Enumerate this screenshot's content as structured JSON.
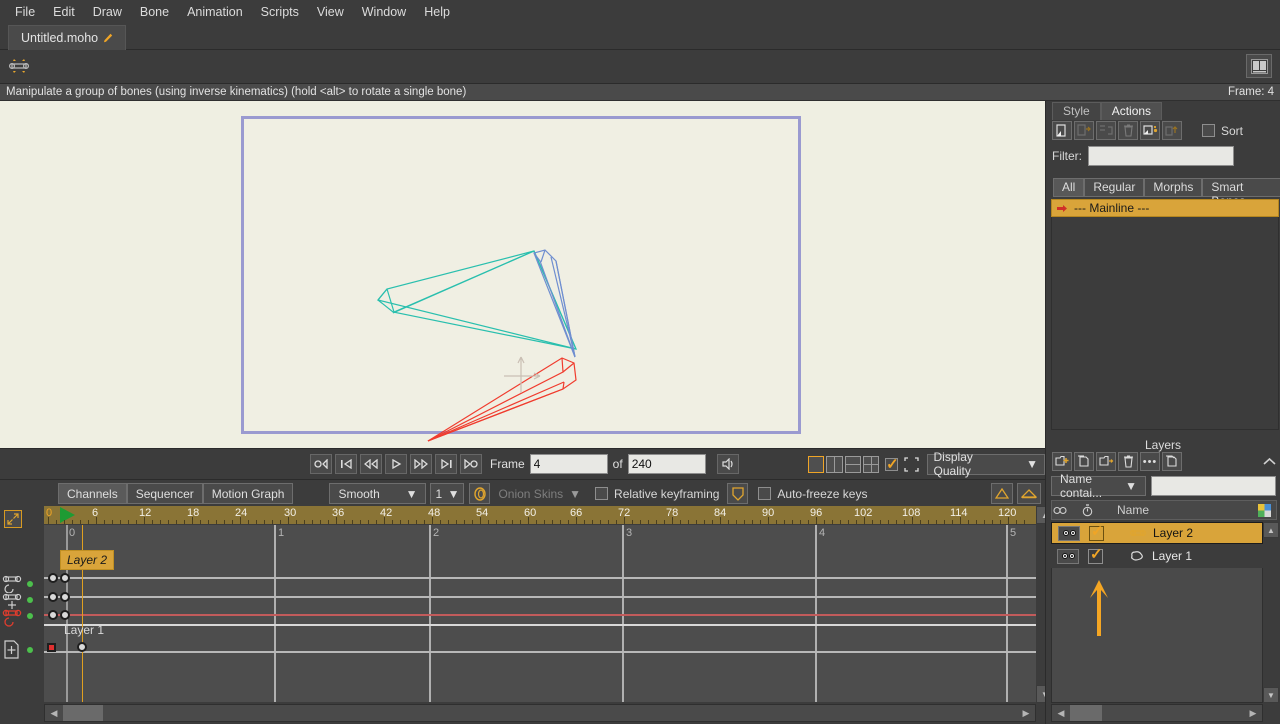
{
  "menu": {
    "items": [
      "File",
      "Edit",
      "Draw",
      "Bone",
      "Animation",
      "Scripts",
      "View",
      "Window",
      "Help"
    ]
  },
  "tabbar": {
    "document_tab": "Untitled.moho",
    "modified_marker": "✎"
  },
  "toolstrip": {
    "active_tool_icon": "manipulate-bones-icon",
    "right_icon": "book-view-icon"
  },
  "statusbar": {
    "hint": "Manipulate a group of bones (using inverse kinematics) (hold <alt> to rotate a single bone)",
    "frame_label": "Frame: 4"
  },
  "canvas": {
    "paper_color": "#f0efe3",
    "border_color": "#9a9ad0",
    "bones": [
      {
        "name": "bone-upper-arm",
        "color": "#29bfae"
      },
      {
        "name": "bone-forearm",
        "color": "#6f8ed0"
      },
      {
        "name": "bone-selected",
        "color": "#f03c2e"
      }
    ],
    "origin_gizmo": "axis-gizmo"
  },
  "playback": {
    "buttons": [
      {
        "name": "rewind-to-start-button",
        "glyph": "◁|"
      },
      {
        "name": "previous-keyframe-button",
        "glyph": "|◁"
      },
      {
        "name": "step-back-button",
        "glyph": "◁◁"
      },
      {
        "name": "play-button",
        "glyph": "▷"
      },
      {
        "name": "step-forward-button",
        "glyph": "▷▷"
      },
      {
        "name": "next-keyframe-button",
        "glyph": "▷|"
      },
      {
        "name": "go-to-end-button",
        "glyph": "▷○"
      }
    ],
    "frame_label": "Frame",
    "frame_value": "4",
    "of_label": "of",
    "total_frames": "240",
    "audio_button": "speaker-icon",
    "layout_buttons": [
      "single-view",
      "two-pane-view",
      "stacked-view",
      "quad-view"
    ],
    "layout_selected_index": 0,
    "toggle_checked": true,
    "camera_icon": "camera-frame-icon",
    "display_quality_label": "Display Quality"
  },
  "timeline_toolbar": {
    "mode_tabs": [
      {
        "label": "Channels",
        "active": true
      },
      {
        "label": "Sequencer",
        "active": false
      },
      {
        "label": "Motion Graph",
        "active": false
      }
    ],
    "interpolation": "Smooth",
    "interp_amount": "1",
    "onion_icon": "onion-skin-icon",
    "onion_label": "Onion Skins",
    "relative_keyframing_label": "Relative keyframing",
    "relative_keyframing_checked": false,
    "shield_icon": "freeze-shield-icon",
    "auto_freeze_label": "Auto-freeze keys",
    "auto_freeze_checked": false,
    "right_icons": [
      "ease-in-icon",
      "ease-both-icon"
    ]
  },
  "timeline": {
    "ruler_ticks": [
      "0",
      "6",
      "12",
      "18",
      "24",
      "30",
      "36",
      "42",
      "48",
      "54",
      "60",
      "66",
      "72",
      "78",
      "84",
      "90",
      "96",
      "102",
      "108",
      "114",
      "120"
    ],
    "ruler_bg": "#8a7436",
    "playhead_frame": 4,
    "second_markers": [
      "0",
      "1",
      "2",
      "3",
      "4",
      "5"
    ],
    "channels": [
      {
        "name": "bone-rotation-channel",
        "icon": "bone-rotate-icon",
        "enabled": true,
        "keys": [
          0,
          2
        ]
      },
      {
        "name": "bone-translation-channel",
        "icon": "bone-translate-icon",
        "enabled": true,
        "keys": [
          0,
          2
        ]
      },
      {
        "name": "bone-selected-channel",
        "icon": "bone-red-icon",
        "enabled": true,
        "keys": [
          0,
          2
        ],
        "highlight": true
      },
      {
        "name": "layer-transform-channel",
        "icon": "layer-transform-icon",
        "enabled": true,
        "keys": [
          0,
          4
        ]
      }
    ],
    "layer_chip": "Layer 2",
    "layer_row_label": "Layer 1",
    "expand_icon": "expand-diagonal-icon"
  },
  "right_panel": {
    "tabs": [
      {
        "label": "Style",
        "active": false
      },
      {
        "label": "Actions",
        "active": true
      }
    ],
    "action_buttons": [
      {
        "name": "new-action-button",
        "enabled": true
      },
      {
        "name": "duplicate-action-button",
        "enabled": false
      },
      {
        "name": "merge-action-button",
        "enabled": false
      },
      {
        "name": "delete-action-button",
        "enabled": false
      },
      {
        "name": "add-reference-button",
        "enabled": true
      },
      {
        "name": "extract-action-button",
        "enabled": false
      }
    ],
    "sort_label": "Sort",
    "sort_checked": false,
    "filter_label": "Filter:",
    "filter_value": "",
    "category_tabs": [
      {
        "label": "All",
        "active": true
      },
      {
        "label": "Regular",
        "active": false
      },
      {
        "label": "Morphs",
        "active": false
      },
      {
        "label": "Smart Bones",
        "active": false
      }
    ],
    "mainline_row": "--- Mainline ---",
    "mainline_icon": "arrow-right-icon"
  },
  "layers_panel": {
    "title": "Layers",
    "toolbar_buttons": [
      {
        "name": "new-layer-button"
      },
      {
        "name": "duplicate-layer-button"
      },
      {
        "name": "new-group-button"
      },
      {
        "name": "delete-layer-button"
      },
      {
        "name": "more-options-button"
      },
      {
        "name": "copy-layer-button"
      }
    ],
    "collapse_icon": "chevron-up-icon",
    "search_mode": "Name contai...",
    "search_value": "",
    "columns": [
      {
        "name": "visibility-column",
        "icon": "eye-icon"
      },
      {
        "name": "timing-column",
        "icon": "stopwatch-icon"
      },
      {
        "name": "name-column",
        "label": "Name"
      }
    ],
    "color_swatch": "color-swatch-icon",
    "rows": [
      {
        "name": "Layer 2",
        "icon": "bone-layer-icon",
        "visible": true,
        "checked": true,
        "selected": true
      },
      {
        "name": "Layer 1",
        "icon": "vector-layer-icon",
        "visible": true,
        "checked": true,
        "selected": false
      }
    ],
    "annotation_arrow": {
      "name": "annotation-arrow-up",
      "color": "#f5a623"
    }
  },
  "colors": {
    "accent": "#f0a526",
    "selection": "#d9a43a",
    "panel_bg": "#3c3c3c",
    "timeline_bg": "#4d4d4d",
    "ruler_bg": "#8a7436"
  }
}
